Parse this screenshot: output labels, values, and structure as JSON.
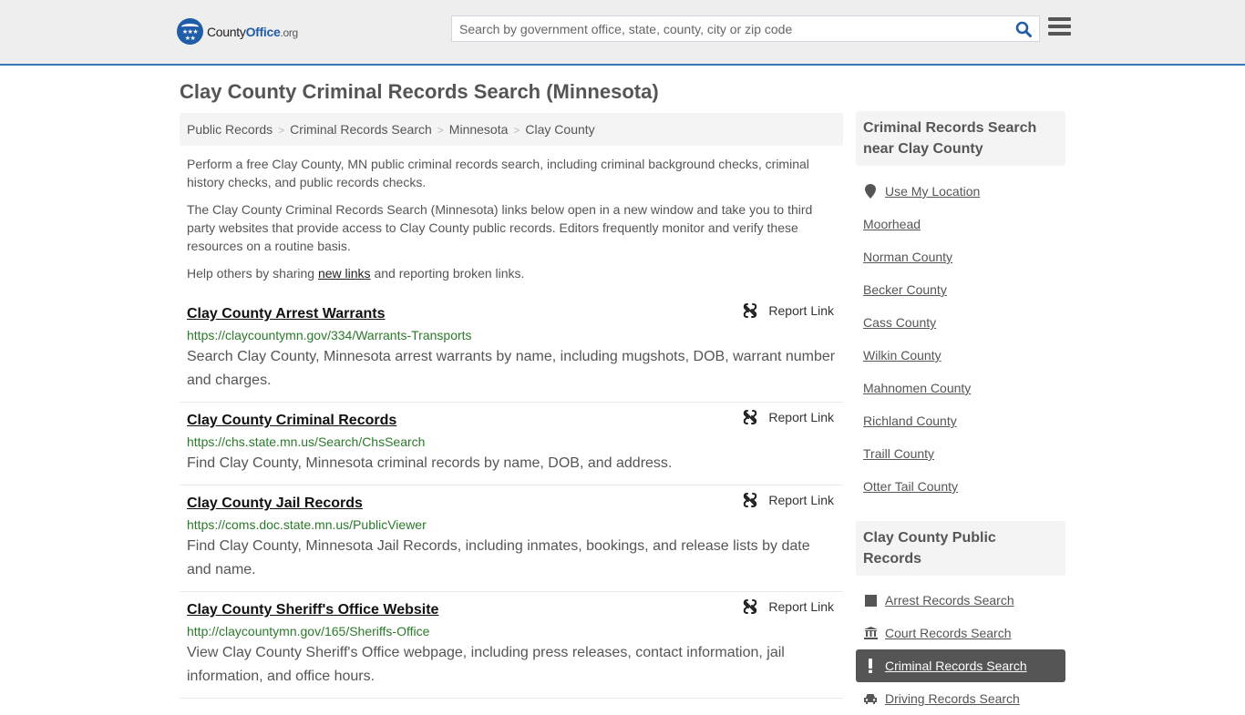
{
  "header": {
    "logo": {
      "part1": "County",
      "part2": "Office",
      "part3": ".org"
    },
    "search_placeholder": "Search by government office, state, county, city or zip code",
    "search_icon": "search-icon",
    "menu_icon": "hamburger-menu-icon"
  },
  "page_title": "Clay County Criminal Records Search (Minnesota)",
  "breadcrumb": [
    {
      "label": "Public Records"
    },
    {
      "label": "Criminal Records Search"
    },
    {
      "label": "Minnesota"
    },
    {
      "label": "Clay County"
    }
  ],
  "intro": {
    "p1": "Perform a free Clay County, MN public criminal records search, including criminal background checks, criminal history checks, and public records checks.",
    "p2": "The Clay County Criminal Records Search (Minnesota) links below open in a new window and take you to third party websites that provide access to Clay County public records. Editors frequently monitor and verify these resources on a routine basis.",
    "p3_before": "Help others by sharing ",
    "p3_link": "new links",
    "p3_after": " and reporting broken links."
  },
  "records": [
    {
      "title": "Clay County Arrest Warrants",
      "url": "https://claycountymn.gov/334/Warrants-Transports",
      "description": "Search Clay County, Minnesota arrest warrants by name, including mugshots, DOB, warrant number and charges.",
      "report_label": "Report Link"
    },
    {
      "title": "Clay County Criminal Records",
      "url": "https://chs.state.mn.us/Search/ChsSearch",
      "description": "Find Clay County, Minnesota criminal records by name, DOB, and address.",
      "report_label": "Report Link"
    },
    {
      "title": "Clay County Jail Records",
      "url": "https://coms.doc.state.mn.us/PublicViewer",
      "description": "Find Clay County, Minnesota Jail Records, including inmates, bookings, and release lists by date and name.",
      "report_label": "Report Link"
    },
    {
      "title": "Clay County Sheriff's Office Website",
      "url": "http://claycountymn.gov/165/Sheriffs-Office",
      "description": "View Clay County Sheriff's Office webpage, including press releases, contact information, jail information, and office hours.",
      "report_label": "Report Link"
    }
  ],
  "sidebar": {
    "near_heading": "Criminal Records Search near Clay County",
    "use_location": "Use My Location",
    "near_items": [
      "Moorhead",
      "Norman County",
      "Becker County",
      "Cass County",
      "Wilkin County",
      "Mahnomen County",
      "Richland County",
      "Traill County",
      "Otter Tail County"
    ],
    "public_heading": "Clay County Public Records",
    "public_items": [
      {
        "label": "Arrest Records Search",
        "icon": "square-icon",
        "active": false
      },
      {
        "label": "Court Records Search",
        "icon": "courthouse-icon",
        "active": false
      },
      {
        "label": "Criminal Records Search",
        "icon": "exclamation-icon",
        "active": true
      },
      {
        "label": "Driving Records Search",
        "icon": "car-icon",
        "active": false
      }
    ]
  },
  "colors": {
    "accent_blue": "#1f5da8",
    "header_border": "#3579b8",
    "url_green": "#2b7a2b",
    "active_bg": "#555555"
  }
}
